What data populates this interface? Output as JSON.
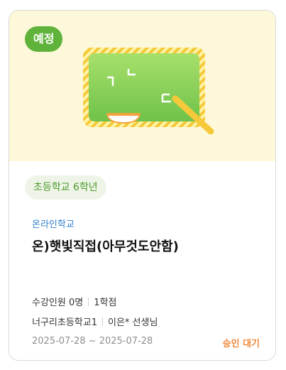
{
  "card": {
    "status_badge": "예정",
    "grade": "초등학교 6학년",
    "category": "온라인학교",
    "title": "온)햇빛직접(아무것도안함)",
    "enrollment": "수강인원 0명",
    "credits": "1학점",
    "school": "너구리초등학교1",
    "teacher": "이은* 선생님",
    "date_range": "2025-07-28 ~ 2025-07-28",
    "approval_status": "승인 대기"
  },
  "colors": {
    "badge": "#5fb23a",
    "hero_bg": "#fdf8d9",
    "grade_text": "#4e9a2b",
    "category_text": "#2f7fd0",
    "approval_text": "#ef8a3c"
  },
  "icons": [
    "chalkboard-illustration"
  ]
}
